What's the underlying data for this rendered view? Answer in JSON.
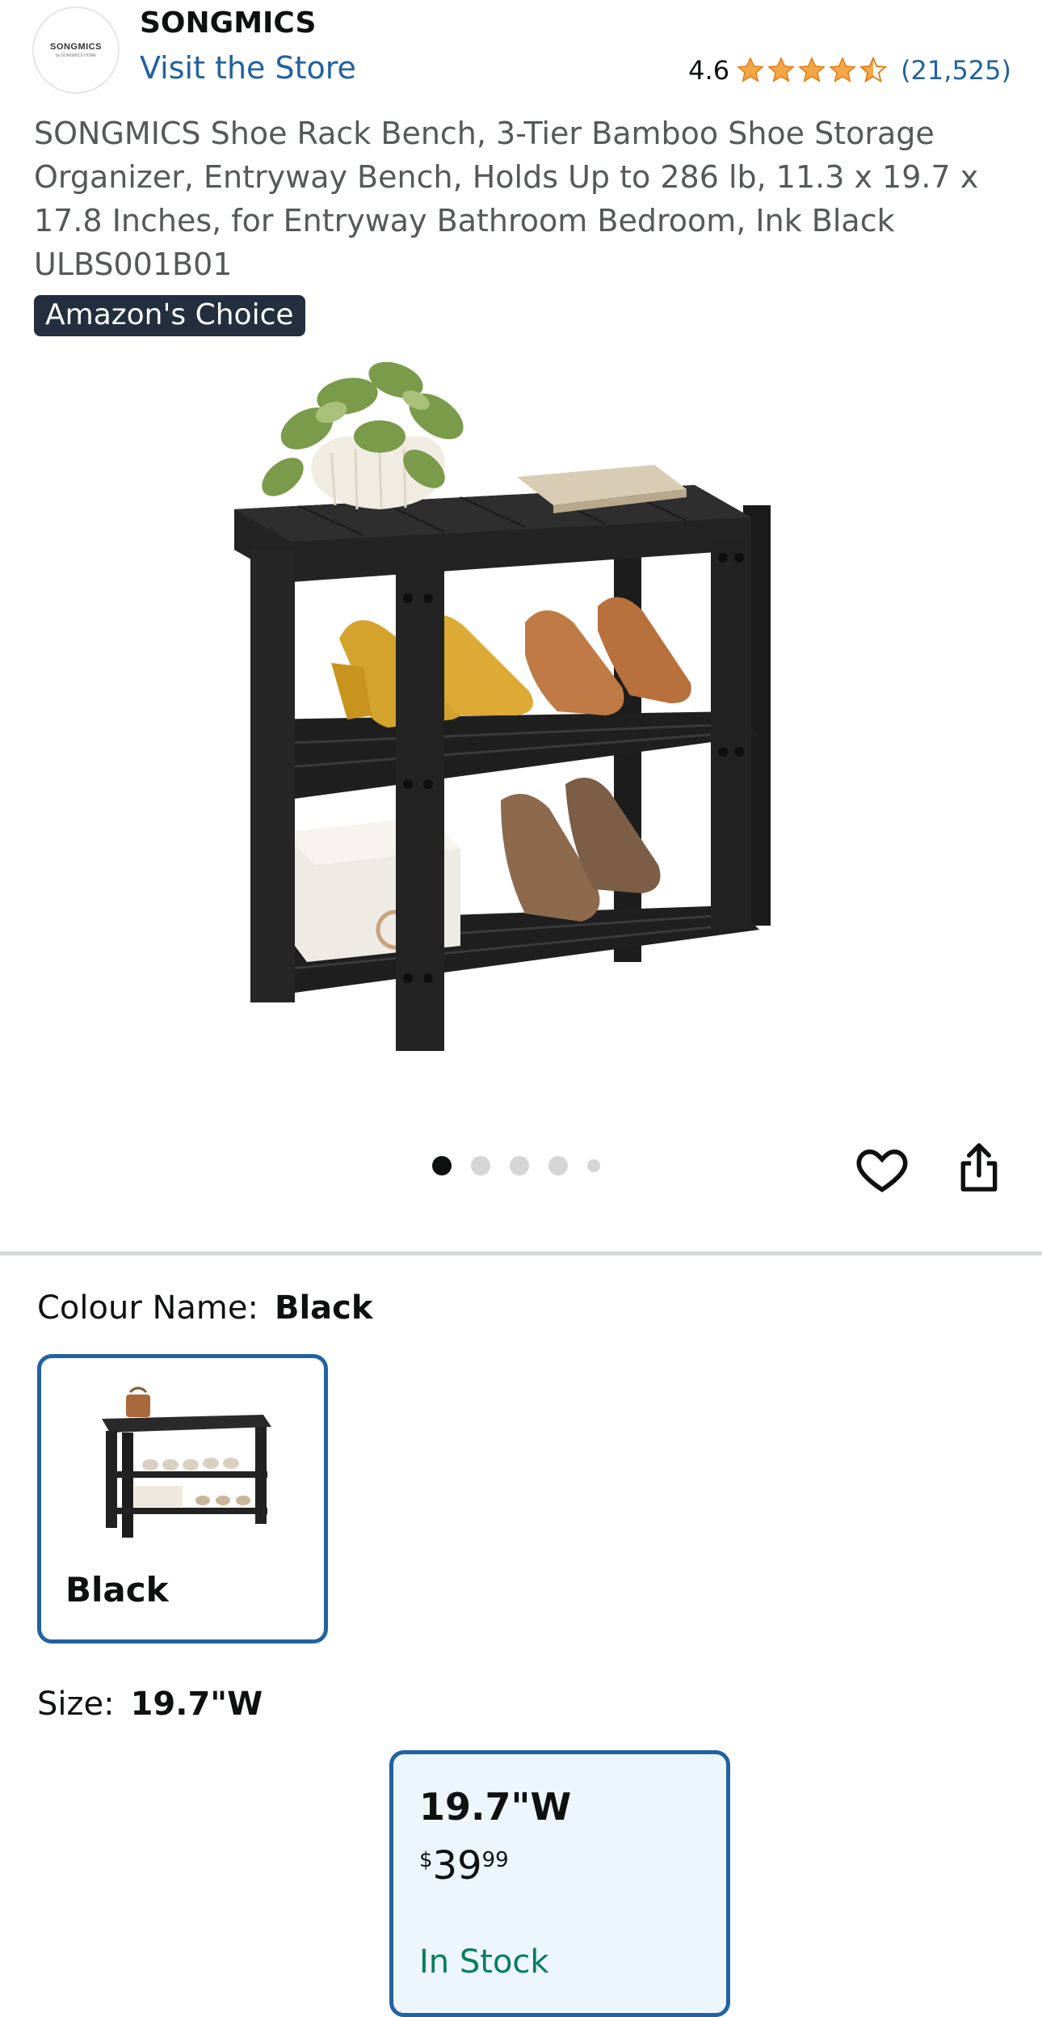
{
  "header": {
    "logo_text": "SONGMICS",
    "logo_subtext": "by SONGMICS HOME",
    "brand": "SONGMICS",
    "visit_store": "Visit the Store",
    "rating_value": "4.6",
    "rating_stars": 4.6,
    "rating_count": "(21,525)",
    "star_color": "#f3a847"
  },
  "product": {
    "title": "SONGMICS Shoe Rack Bench, 3-Tier Bamboo Shoe Storage Organizer, Entryway Bench, Holds Up to 286 lb, 11.3 x 19.7 x 17.8 Inches, for Entryway Bathroom Bedroom, Ink Black ULBS001B01",
    "badge": "Amazon's Choice",
    "image_count": 5,
    "active_image": 1
  },
  "icons": {
    "wishlist": "heart-icon",
    "share": "share-icon"
  },
  "colour": {
    "label": "Colour Name:",
    "selected": "Black",
    "options": [
      {
        "name": "Black"
      }
    ]
  },
  "size": {
    "label": "Size:",
    "selected": "19.7\"W",
    "options": [
      {
        "name": "19.7\"W",
        "price_symbol": "$",
        "price_whole": "39",
        "price_fraction": "99",
        "availability": "In Stock"
      }
    ]
  },
  "colors": {
    "link": "#2162a1",
    "selected_border": "#2162a1",
    "selected_bg": "#edf6fc",
    "in_stock": "#067d62",
    "badge_bg": "#232f3e"
  }
}
